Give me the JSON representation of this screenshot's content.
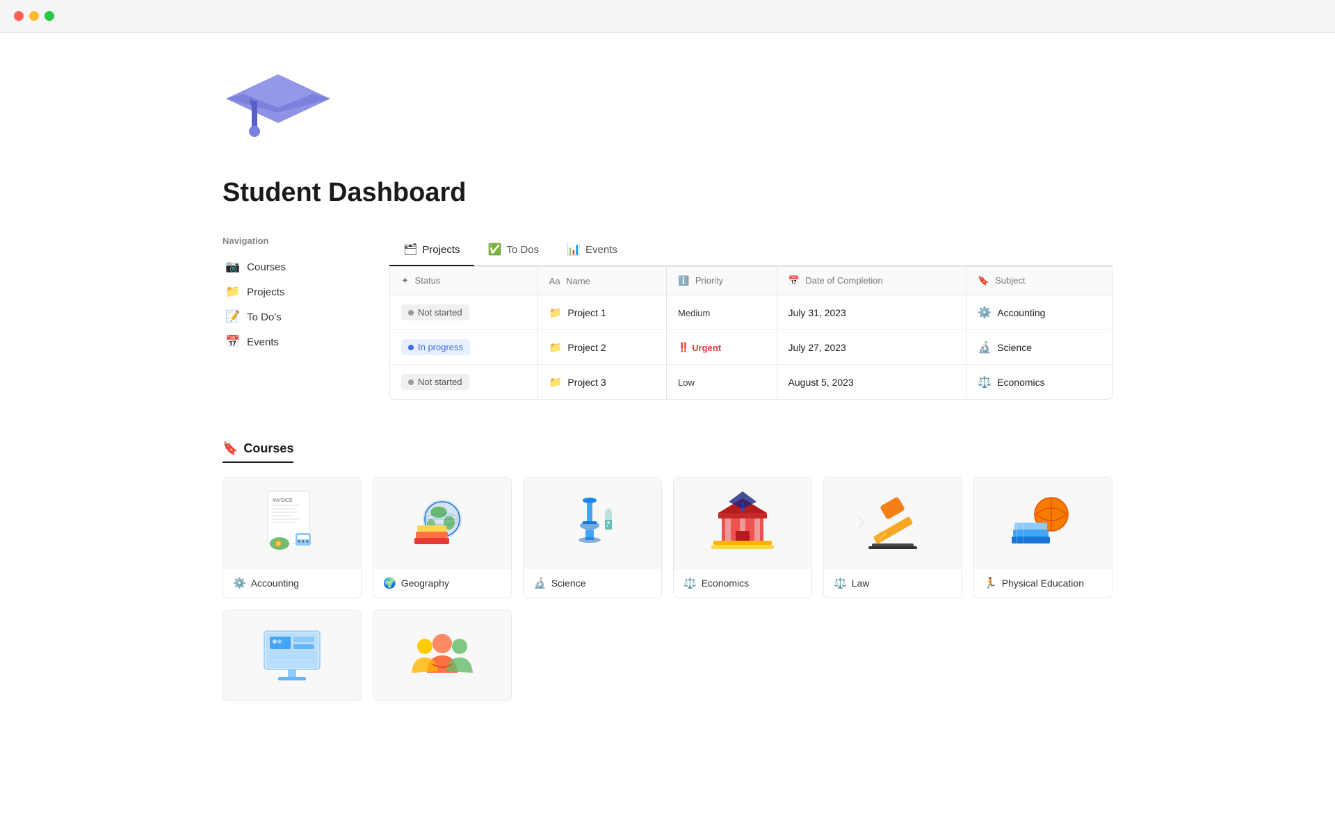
{
  "titlebar": {
    "buttons": [
      "close",
      "minimize",
      "maximize"
    ]
  },
  "hero": {
    "emoji": "🎓",
    "title": "Student Dashboard"
  },
  "navigation": {
    "label": "Navigation",
    "items": [
      {
        "id": "courses",
        "label": "Courses",
        "icon": "📷"
      },
      {
        "id": "projects",
        "label": "Projects",
        "icon": "📁"
      },
      {
        "id": "todos",
        "label": "To Do's",
        "icon": "📝"
      },
      {
        "id": "events",
        "label": "Events",
        "icon": "📅"
      }
    ]
  },
  "tabs": [
    {
      "id": "projects",
      "label": "Projects",
      "icon": "🗂",
      "active": true
    },
    {
      "id": "todos",
      "label": "To Dos",
      "icon": "✅"
    },
    {
      "id": "events",
      "label": "Events",
      "icon": "📊"
    }
  ],
  "table": {
    "columns": [
      {
        "id": "status",
        "label": "Status",
        "icon": "✦"
      },
      {
        "id": "name",
        "label": "Name",
        "icon": "Aa"
      },
      {
        "id": "priority",
        "label": "Priority",
        "icon": "ℹ"
      },
      {
        "id": "date",
        "label": "Date of Completion",
        "icon": "📅"
      },
      {
        "id": "subject",
        "label": "Subject",
        "icon": "🔖"
      }
    ],
    "rows": [
      {
        "status": "Not started",
        "statusType": "gray",
        "name": "Project 1",
        "priority": "Medium",
        "priorityType": "medium",
        "date": "July 31, 2023",
        "subject": "Accounting",
        "subjectIcon": "⚙️"
      },
      {
        "status": "In progress",
        "statusType": "blue",
        "name": "Project 2",
        "priority": "Urgent",
        "priorityType": "urgent",
        "date": "July 27, 2023",
        "subject": "Science",
        "subjectIcon": "🔬"
      },
      {
        "status": "Not started",
        "statusType": "gray",
        "name": "Project 3",
        "priority": "Low",
        "priorityType": "low",
        "date": "August 5, 2023",
        "subject": "Economics",
        "subjectIcon": "⚖️"
      }
    ]
  },
  "courses": {
    "header_icon": "🔖",
    "header_label": "Courses",
    "items": [
      {
        "id": "accounting",
        "label": "Accounting",
        "icon": "⚙️",
        "emoji": "🧾"
      },
      {
        "id": "geography",
        "label": "Geography",
        "icon": "🌍",
        "emoji": "🌍"
      },
      {
        "id": "science",
        "label": "Science",
        "icon": "🔬",
        "emoji": "🔬"
      },
      {
        "id": "economics",
        "label": "Economics",
        "icon": "⚖️",
        "emoji": "🏛"
      },
      {
        "id": "law",
        "label": "Law",
        "icon": "⚖️",
        "emoji": "🔨"
      },
      {
        "id": "physical-education",
        "label": "Physical Education",
        "icon": "🏃",
        "emoji": "🏀"
      }
    ],
    "row2": [
      {
        "id": "it",
        "label": "",
        "emoji": "🖥"
      },
      {
        "id": "social",
        "label": "",
        "emoji": "👥"
      }
    ]
  }
}
